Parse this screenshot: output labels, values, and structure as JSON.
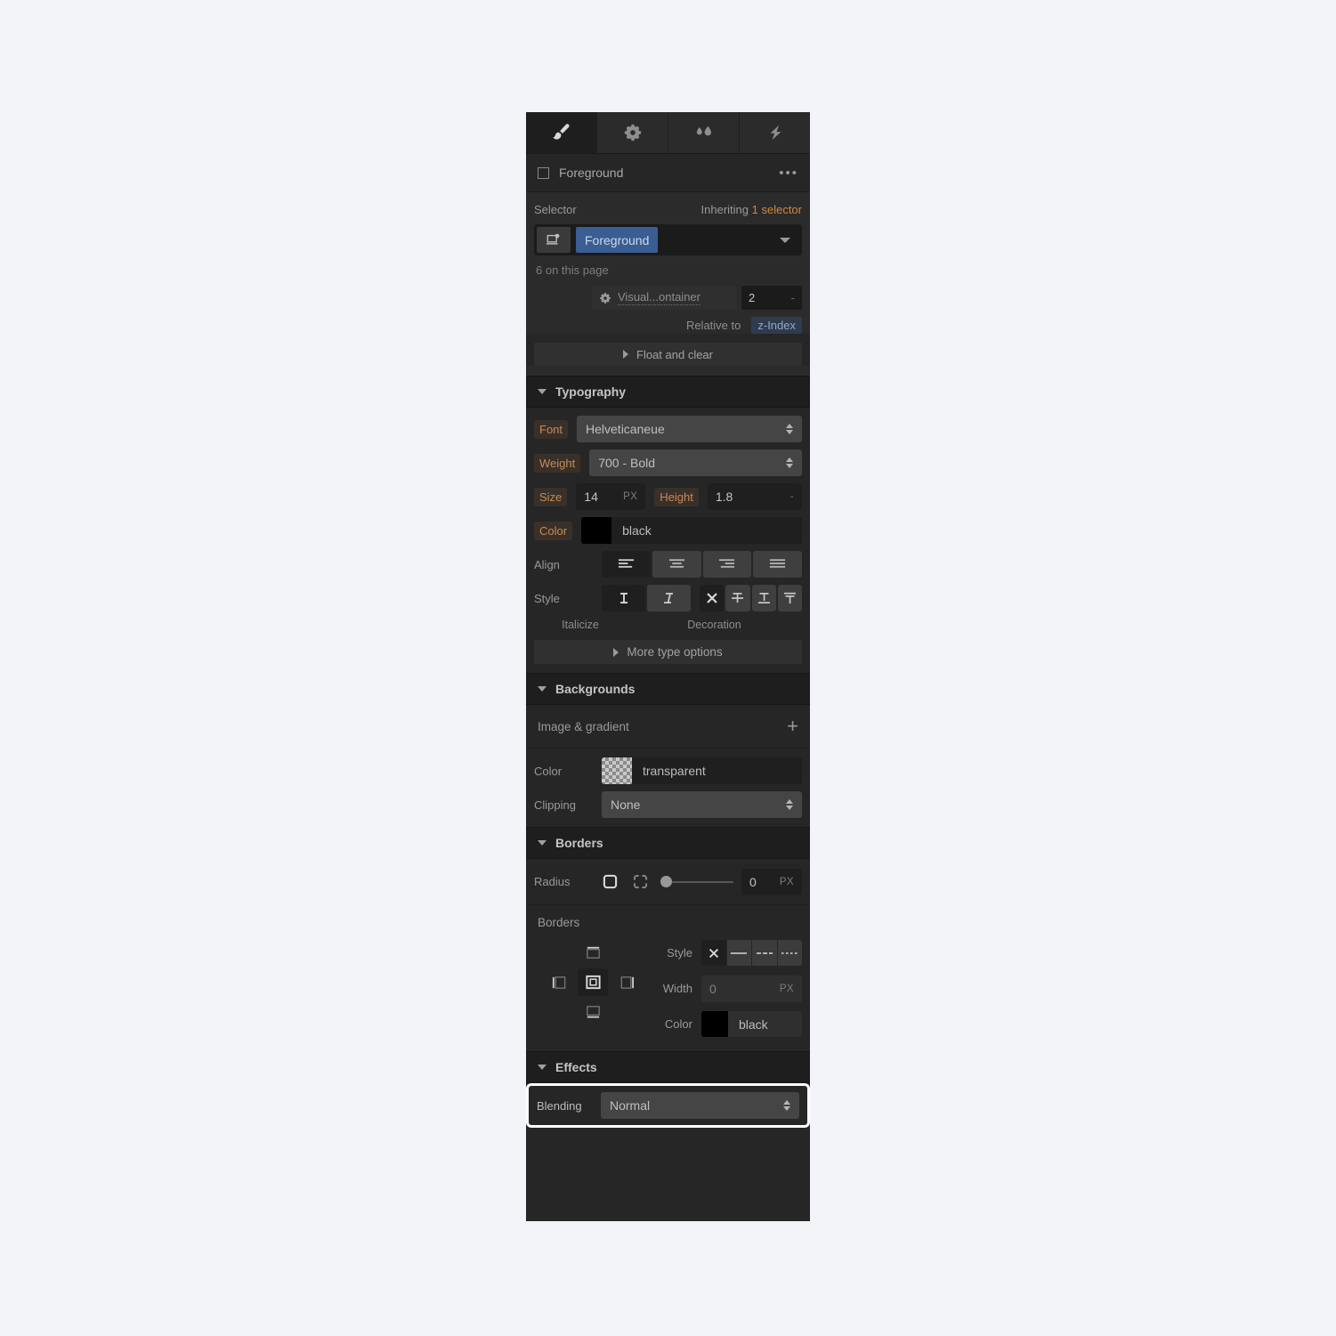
{
  "panel": {
    "tabs": [
      {
        "name": "style-tab",
        "icon": "paintbrush-icon",
        "active": true
      },
      {
        "name": "settings-tab",
        "icon": "gear-icon",
        "active": false
      },
      {
        "name": "interactions-tab",
        "icon": "water-drops-icon",
        "active": false
      },
      {
        "name": "effects-tab",
        "icon": "lightning-bolt-icon",
        "active": false
      }
    ],
    "element_header": {
      "title": "Foreground",
      "menu": "•••"
    },
    "selector": {
      "label": "Selector",
      "inheriting_prefix": "Inheriting",
      "inheriting_count": "1 selector",
      "chip": "Foreground",
      "count_note": "6 on this page"
    },
    "zindex": {
      "label": "Visual...ontainer",
      "value": "2",
      "unit": "-",
      "relative_label": "Relative to",
      "relative_value": "z-Index"
    },
    "float_and_clear": "Float and clear"
  },
  "typography": {
    "title": "Typography",
    "font_label": "Font",
    "font_value": "Helveticaneue",
    "weight_label": "Weight",
    "weight_value": "700 - Bold",
    "size_label": "Size",
    "size_value": "14",
    "size_unit": "PX",
    "height_label": "Height",
    "height_value": "1.8",
    "height_unit": "-",
    "color_label": "Color",
    "color_value": "black",
    "color_hex": "#000000",
    "align_label": "Align",
    "align_options": [
      "align-left",
      "align-center",
      "align-right",
      "align-justify"
    ],
    "align_selected": 0,
    "style_label": "Style",
    "italic_options": [
      "upright",
      "italic"
    ],
    "italic_selected": 0,
    "decoration_options": [
      "none",
      "strikethrough",
      "underline",
      "overline"
    ],
    "decoration_selected": 0,
    "italicize_caption": "Italicize",
    "decoration_caption": "Decoration",
    "more_type_options": "More type options"
  },
  "backgrounds": {
    "title": "Backgrounds",
    "image_gradient_label": "Image & gradient",
    "add_symbol": "+",
    "color_label": "Color",
    "color_value": "transparent",
    "clipping_label": "Clipping",
    "clipping_value": "None"
  },
  "borders": {
    "title": "Borders",
    "radius_label": "Radius",
    "radius_value": "0",
    "radius_unit": "PX",
    "borders_label": "Borders",
    "side_selected": "all",
    "style_label": "Style",
    "style_options": [
      "none",
      "solid",
      "dashed",
      "dotted"
    ],
    "style_selected": 0,
    "width_label": "Width",
    "width_value": "0",
    "width_unit": "PX",
    "color_label": "Color",
    "color_value": "black",
    "color_hex": "#000000"
  },
  "effects": {
    "title": "Effects",
    "blending_label": "Blending",
    "blending_value": "Normal"
  },
  "colors": {
    "panel_bg": "#262626",
    "section_header_bg": "#1e1e1e",
    "accent_orange": "#c98a52",
    "accent_blue": "#3a5d93",
    "page_bg": "#f2f4f7"
  }
}
